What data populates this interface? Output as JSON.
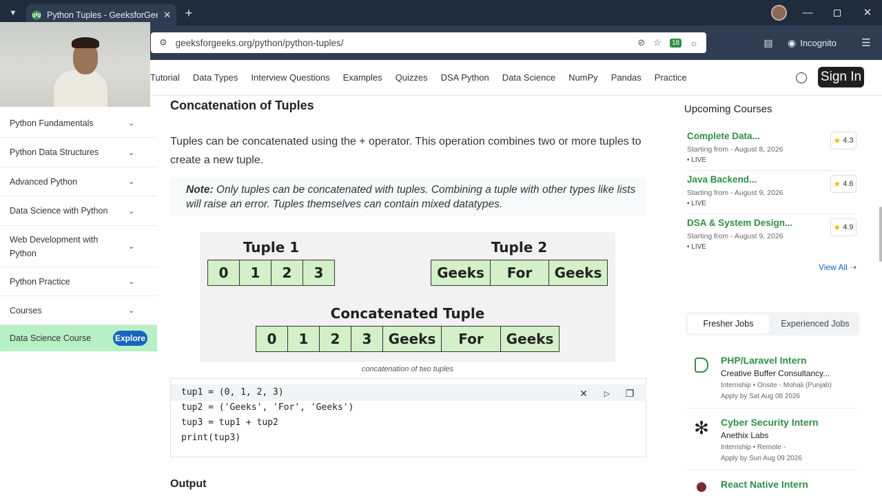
{
  "browser": {
    "tab_title": "Python Tuples - GeeksforGeek",
    "favicon_text": "gfg",
    "url": "geeksforgeeks.org/python/python-tuples/",
    "incognito_label": "Incognito",
    "extension_badge": "18"
  },
  "site_nav": {
    "items": [
      "Tutorial",
      "Data Types",
      "Interview Questions",
      "Examples",
      "Quizzes",
      "DSA Python",
      "Data Science",
      "NumPy",
      "Pandas",
      "Practice"
    ],
    "signin_label": "Sign In"
  },
  "sidebar": {
    "items": [
      {
        "label": "Python Fundamentals"
      },
      {
        "label": "Python Data Structures"
      },
      {
        "label": "Advanced Python"
      },
      {
        "label": "Data Science with Python"
      },
      {
        "label": "Web Development with Python"
      },
      {
        "label": "Python Practice"
      },
      {
        "label": "Courses"
      }
    ],
    "promo_label": "Data Science Course",
    "promo_button": "Explore"
  },
  "article": {
    "heading": "Concatenation of Tuples",
    "paragraph": "Tuples can be concatenated using the + operator. This operation combines two or more tuples to create a new tuple.",
    "note_label": "Note:",
    "note_text": " Only tuples can be concatenated with tuples. Combining a tuple with other types like lists will raise an error. Tuples themselves can contain mixed datatypes.",
    "diagram": {
      "tuple1_label": "Tuple 1",
      "tuple1": [
        "0",
        "1",
        "2",
        "3"
      ],
      "tuple2_label": "Tuple 2",
      "tuple2": [
        "Geeks",
        "For",
        "Geeks"
      ],
      "concat_label": "Concatenated Tuple",
      "concat": [
        "0",
        "1",
        "2",
        "3",
        "Geeks",
        "For",
        "Geeks"
      ]
    },
    "caption": "concatenation of two tuples",
    "code_lines": [
      "tup1 = (0, 1, 2, 3)",
      "tup2 = ('Geeks', 'For', 'Geeks')",
      "tup3 = tup1 + tup2",
      "print(tup3)"
    ],
    "output_heading": "Output"
  },
  "right": {
    "upcoming_title": "Upcoming Courses",
    "courses": [
      {
        "name": "Complete Data...",
        "date": "Starting from - August 8, 2026",
        "live": "• LIVE",
        "rating": "4.3"
      },
      {
        "name": "Java Backend...",
        "date": "Starting from - August 9, 2026",
        "live": "• LIVE",
        "rating": "4.6"
      },
      {
        "name": "DSA & System Design...",
        "date": "Starting from - August 9, 2026",
        "live": "• LIVE",
        "rating": "4.9"
      }
    ],
    "view_all": "View All",
    "job_tabs": [
      "Fresher Jobs",
      "Experienced Jobs"
    ],
    "jobs": [
      {
        "title": "PHP/Laravel Intern",
        "company": "Creative Buffer Consultancy...",
        "meta": "Internship • Onsite - Mohali (Punjab)",
        "apply": "Apply by Sat Aug 08 2026"
      },
      {
        "title": "Cyber Security Intern",
        "company": "Anethix Labs",
        "meta": "Internship • Remote -",
        "apply": "Apply by Sun Aug 09 2026"
      },
      {
        "title": "React Native Intern",
        "company": "",
        "meta": "",
        "apply": ""
      }
    ]
  },
  "colors": {
    "gfg_green": "#2f8d46",
    "cell_green": "#d4f0c8",
    "promo_bg": "#b7f0c5",
    "chrome_dark": "#202b3d"
  }
}
